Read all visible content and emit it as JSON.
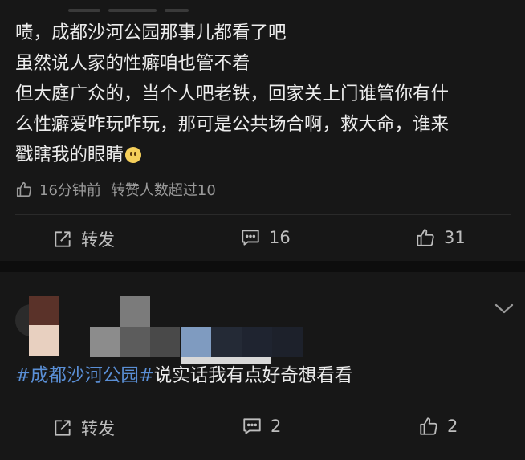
{
  "post": {
    "lines": [
      "啧，成都沙河公园那事儿都看了吧",
      "虽然说人家的性癖咱也管不着",
      "但大庭广众的，当个人吧老铁，回家关上门谁管你有什",
      "么性癖爱咋玩咋玩，那可是公共场合啊，救大命，谁来",
      "戳瞎我的眼睛"
    ],
    "emoji": "slightly-smiling-face",
    "meta_time": "16分钟前",
    "meta_likes": "转赞人数超过10",
    "actions": {
      "repost_label": "转发",
      "comment_count": "16",
      "like_count": "31"
    }
  },
  "comment_post": {
    "hashtag": "#成都沙河公园#",
    "text": "说实话我有点好奇想看看",
    "actions": {
      "repost_label": "转发",
      "comment_count": "2",
      "like_count": "2"
    }
  },
  "colors": {
    "background": "#171717",
    "separator": "#0d0d0d",
    "text": "#ececec",
    "muted": "#9a9a9a",
    "hashtag": "#5a8fd6"
  },
  "icons": {
    "repost": "repost-icon",
    "comment": "comment-icon",
    "like": "thumb-up-icon",
    "expand": "chevron-down-icon"
  }
}
